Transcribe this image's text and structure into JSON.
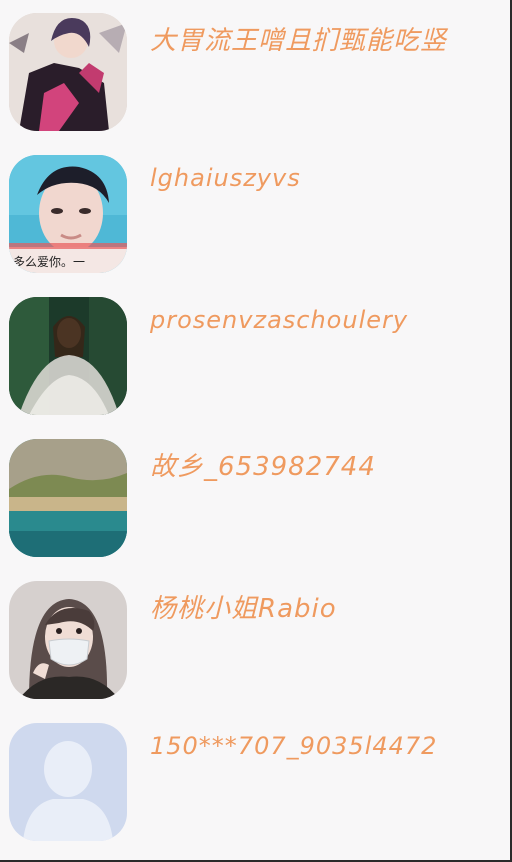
{
  "contacts": [
    {
      "name": "大胃流王噌且扪甄能吃竖",
      "avatar_icon": "anime-boy-avatar-icon"
    },
    {
      "name": "lghaiuszyvs",
      "avatar_icon": "boy-portrait-avatar-icon",
      "avatar_caption": "多么爱你。一"
    },
    {
      "name": "prosenvzaschoulery",
      "avatar_icon": "woman-forest-avatar-icon"
    },
    {
      "name": "故乡_653982744",
      "avatar_icon": "river-landscape-avatar-icon"
    },
    {
      "name": "杨桃小姐Rabio",
      "avatar_icon": "masked-girl-avatar-icon"
    },
    {
      "name": "150***707_9035l4472",
      "avatar_icon": "default-person-avatar-icon"
    }
  ]
}
